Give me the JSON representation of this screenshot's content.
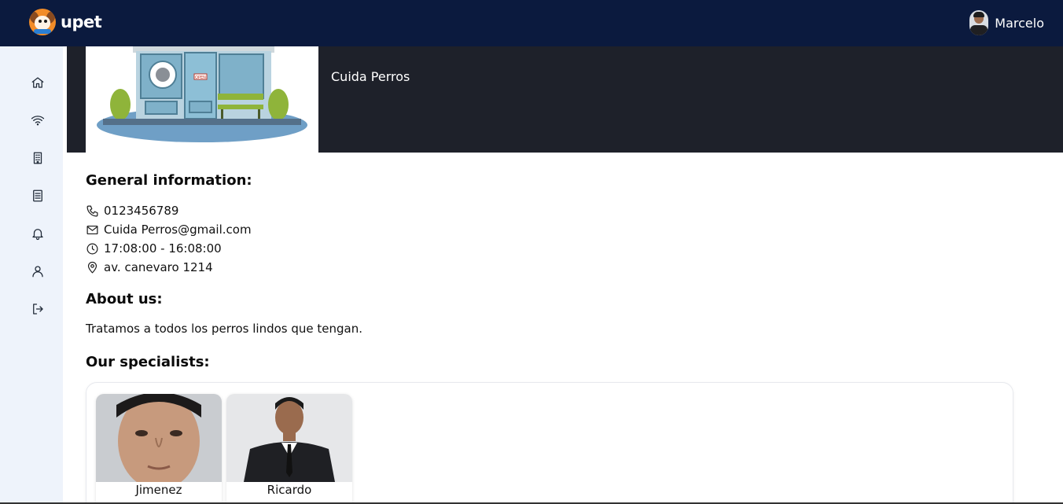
{
  "app": {
    "brand_name": "upet",
    "user_name": "Marcelo"
  },
  "sidebar": {
    "items": [
      {
        "icon": "home-icon"
      },
      {
        "icon": "wifi-icon"
      },
      {
        "icon": "building-icon"
      },
      {
        "icon": "document-icon"
      },
      {
        "icon": "bell-icon"
      },
      {
        "icon": "user-icon"
      },
      {
        "icon": "logout-icon"
      }
    ]
  },
  "banner": {
    "title": "Cuida Perros",
    "sign_text": "OPEN"
  },
  "general": {
    "heading": "General information:",
    "phone": "0123456789",
    "email": "Cuida Perros@gmail.com",
    "hours": "17:08:00 - 16:08:00",
    "address": "av. canevaro 1214"
  },
  "about": {
    "heading": "About us:",
    "text": "Tratamos a todos los perros lindos que tengan."
  },
  "specialists": {
    "heading": "Our specialists:",
    "items": [
      {
        "name": "Jimenez"
      },
      {
        "name": "Ricardo"
      }
    ]
  },
  "colors": {
    "topbar": "#0b1a3e",
    "sidebar": "#eef3fb",
    "banner": "#1e212a"
  }
}
